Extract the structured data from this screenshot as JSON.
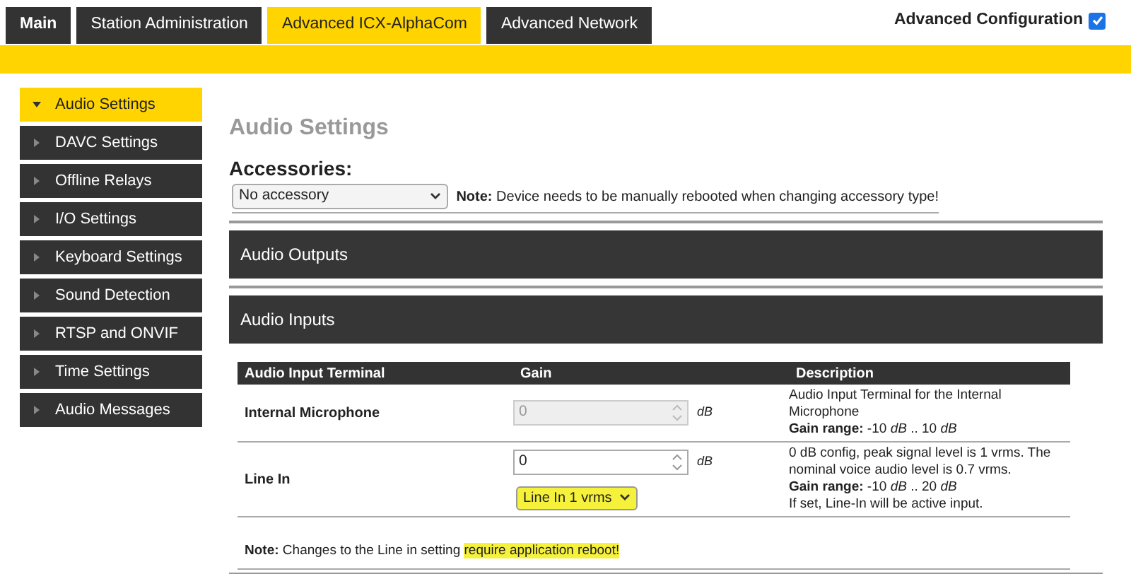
{
  "tabs": [
    {
      "label": "Main",
      "selected": false,
      "bold": true
    },
    {
      "label": "Station Administration",
      "selected": false,
      "bold": false
    },
    {
      "label": "Advanced ICX-AlphaCom",
      "selected": true,
      "bold": false
    },
    {
      "label": "Advanced Network",
      "selected": false,
      "bold": false
    }
  ],
  "advanced_configuration": {
    "label": "Advanced Configuration",
    "checked": true
  },
  "sidebar": {
    "items": [
      {
        "label": "Audio Settings",
        "selected": true
      },
      {
        "label": "DAVC Settings",
        "selected": false
      },
      {
        "label": "Offline Relays",
        "selected": false
      },
      {
        "label": "I/O Settings",
        "selected": false
      },
      {
        "label": "Keyboard Settings",
        "selected": false
      },
      {
        "label": "Sound Detection",
        "selected": false
      },
      {
        "label": "RTSP and ONVIF",
        "selected": false
      },
      {
        "label": "Time Settings",
        "selected": false
      },
      {
        "label": "Audio Messages",
        "selected": false
      }
    ]
  },
  "page_title": "Audio Settings",
  "accessories": {
    "heading": "Accessories:",
    "select_value": "No accessory",
    "note_label": "Note:",
    "note_text": "Device needs to be manually rebooted when changing accessory type!"
  },
  "sections": [
    {
      "title": "Audio Outputs"
    },
    {
      "title": "Audio Inputs"
    }
  ],
  "table": {
    "columns": [
      "Audio Input Terminal",
      "Gain",
      "Description"
    ],
    "rows": [
      {
        "terminal": "Internal Microphone",
        "gain": "0",
        "unit": "dB",
        "disabled": true,
        "description": [
          "Audio Input Terminal for the Internal Microphone",
          "**Gain range:** -10 *dB* .. 10 *dB*"
        ]
      },
      {
        "terminal": "Line In",
        "gain": "0",
        "unit": "dB",
        "disabled": false,
        "select": {
          "value": "Line In 1 vrms",
          "highlighted": true
        },
        "description": [
          "0 dB config, peak signal level is 1 vrms. The nominal voice audio level is 0.7 vrms.",
          "**Gain range:** -10 *dB* .. 20 *dB*",
          "If set, Line-In will be active input."
        ]
      }
    ]
  },
  "footer_note": {
    "label": "Note:",
    "text": "Changes to the Line in setting ",
    "highlight": "require application reboot!",
    "highlighted": true
  }
}
